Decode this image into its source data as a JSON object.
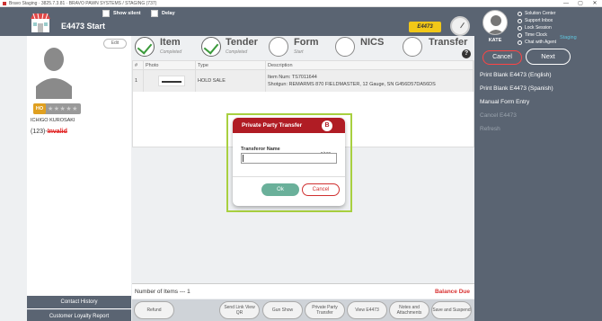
{
  "titlebar": {
    "text": "Bravo Staging · 3825.7.3.81 · BRAVO PAWN SYSTEMS / STAGING (737)"
  },
  "window_controls": {
    "minimize": "—",
    "restore": "▢",
    "close": "✕"
  },
  "header": {
    "title": "E4473 Start",
    "show_silent": "Show silent",
    "delay": "Delay",
    "brand_badge": "E4473"
  },
  "user": {
    "name": "KATE",
    "utilities": [
      "Solution Center",
      "Support Inbox",
      "Lock Session",
      "Time Clock",
      "Chat with Agent"
    ],
    "environment": "Staging"
  },
  "nav_buttons": {
    "cancel": "Cancel",
    "next": "Next"
  },
  "right_links": [
    {
      "label": "Print Blank E4473 (English)",
      "enabled": true
    },
    {
      "label": "Print Blank E4473 (Spanish)",
      "enabled": true
    },
    {
      "label": "Manual Form Entry",
      "enabled": true
    },
    {
      "label": "Cancel E4473",
      "enabled": false
    },
    {
      "label": "Refresh",
      "enabled": false
    }
  ],
  "customer": {
    "edit": "Edit",
    "badge": "HO",
    "stars": "★★★★★",
    "name": "ICHIGO KUROSAKI",
    "phone_prefix": "(123)-",
    "phone_status": "Invalid"
  },
  "left_footer": {
    "history": "Contact History",
    "loyalty": "Customer Loyalty Report"
  },
  "steps": [
    {
      "name": "Item",
      "status": "Completed",
      "done": true
    },
    {
      "name": "Tender",
      "status": "Completed",
      "done": true
    },
    {
      "name": "Form",
      "status": "Start",
      "done": false
    },
    {
      "name": "NICS",
      "status": "",
      "done": false
    },
    {
      "name": "Transfer",
      "status": "",
      "done": false
    }
  ],
  "help": "?",
  "table": {
    "headers": [
      "#",
      "Photo",
      "Type",
      "Description"
    ],
    "rows": [
      {
        "num": "1",
        "type": "HOLD SALE",
        "desc_line1": "Item Num: TS7011644",
        "desc_line2": "Shotgun: REMARMS 870 FIELDMASTER, 12 Gauge, SN G456D57DA56DS"
      }
    ]
  },
  "footer_bar": {
    "items_count": "Number of Items --- 1",
    "balance": "Balance Due"
  },
  "actions": [
    "Refund",
    "Send Link View QR",
    "Gun Show",
    "Private Party Transfer",
    "View E4473",
    "Notes and Attachments",
    "Save and Suspend"
  ],
  "modal": {
    "title": "Private Party Transfer",
    "logo": "B",
    "field_label": "Transferor Name",
    "field_value": "",
    "counter": "0/100",
    "ok": "Ok",
    "cancel": "Cancel"
  }
}
